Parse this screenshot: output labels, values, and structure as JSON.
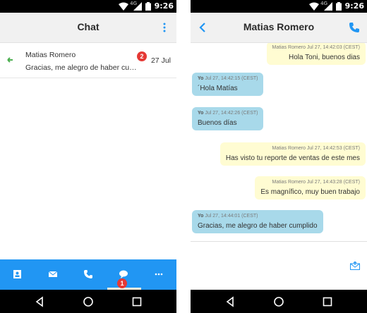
{
  "status_bar": {
    "time": "9:26",
    "network": "4G"
  },
  "conversations_screen": {
    "title": "Chat",
    "conversations": [
      {
        "name": "Matias Romero",
        "preview": "Gracias, me alegro de haber cumplido",
        "unread": "2",
        "date": "27 Jul"
      }
    ],
    "bottom_nav": {
      "items": [
        "contacts-icon",
        "mail-icon",
        "phone-icon",
        "chat-icon",
        "more-icon"
      ],
      "active": "chat-icon",
      "chat_badge": "1"
    }
  },
  "chat_screen": {
    "title": "Matias Romero",
    "messages": [
      {
        "direction": "out",
        "meta": "Matias Romero Jul 27, 14:42:03 (CEST)",
        "text": "Hola Toni, buenos dias"
      },
      {
        "direction": "in",
        "sender": "Yo",
        "meta": "Jul 27, 14:42:15 (CEST)",
        "text": "´Hola Matías"
      },
      {
        "direction": "in",
        "sender": "Yo",
        "meta": "Jul 27, 14:42:26 (CEST)",
        "text": "Buenos días"
      },
      {
        "direction": "out",
        "meta": "Matias Romero Jul 27, 14:42:53 (CEST)",
        "text": "Has visto tu reporte de ventas de este mes"
      },
      {
        "direction": "out",
        "meta": "Matias Romero Jul 27, 14:43:28 (CEST)",
        "text": "Es magnífico, muy buen trabajo"
      },
      {
        "direction": "in",
        "sender": "Yo",
        "meta": "Jul 27, 14:44:01 (CEST)",
        "text": "Gracias, me alegro de haber cumplido"
      }
    ],
    "composer_placeholder": ""
  },
  "colors": {
    "accent": "#2196f3",
    "badge": "#e53935",
    "incoming_bubble": "#a8d9ea",
    "outgoing_bubble": "#fffcd2",
    "preview_arrow": "#4caf50"
  }
}
